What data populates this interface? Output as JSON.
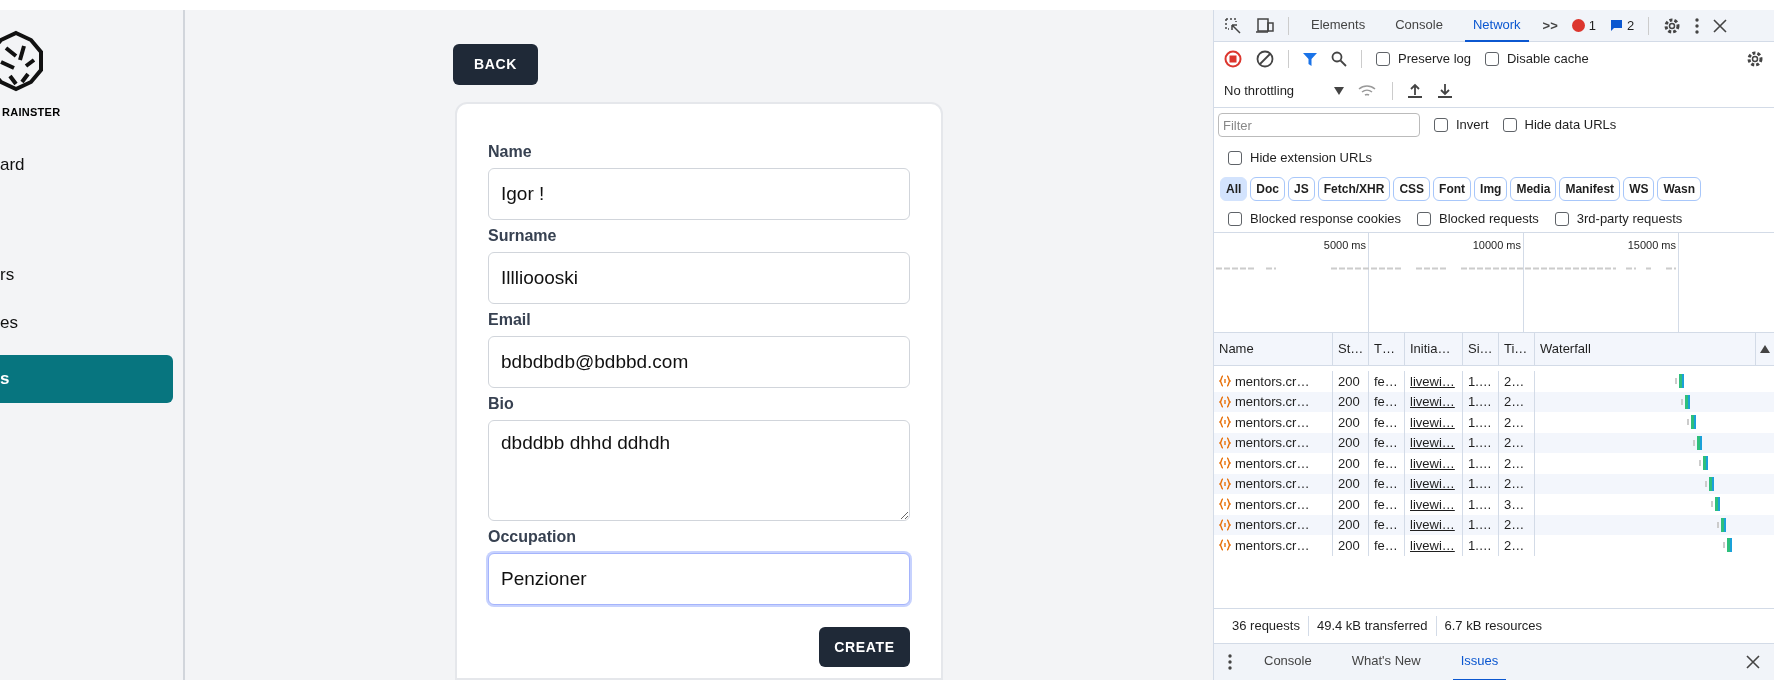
{
  "sidebar": {
    "logo_text": "RAINSTER",
    "items": [
      {
        "label": "ard",
        "selected": false
      },
      {
        "label": "rs",
        "selected": false
      },
      {
        "label": "es",
        "selected": false
      },
      {
        "label": "s",
        "selected": true
      }
    ]
  },
  "back_button": "BACK",
  "form": {
    "fields": [
      {
        "kind": "input",
        "label": "Name",
        "value": "Igor !",
        "focused": false
      },
      {
        "kind": "input",
        "label": "Surname",
        "value": "Illlioooski",
        "focused": false
      },
      {
        "kind": "input",
        "label": "Email",
        "value": "bdbdbdb@bdbbd.com",
        "focused": false
      },
      {
        "kind": "textarea",
        "label": "Bio",
        "value": "dbddbb dhhd ddhdh",
        "focused": false
      },
      {
        "kind": "input",
        "label": "Occupation",
        "value": "Penzioner",
        "focused": true
      }
    ],
    "submit": "CREATE"
  },
  "devtools": {
    "tabs": [
      {
        "label": "Elements",
        "selected": false
      },
      {
        "label": "Console",
        "selected": false
      },
      {
        "label": "Network",
        "selected": true
      }
    ],
    "more": ">>",
    "errors": "1",
    "messages": "2",
    "checkboxes_1": [
      {
        "label": "Preserve log",
        "checked": false
      },
      {
        "label": "Disable cache",
        "checked": false
      }
    ],
    "throttling": "No throttling",
    "filter_placeholder": "Filter",
    "checkboxes_2": [
      {
        "label": "Invert",
        "checked": false
      },
      {
        "label": "Hide data URLs",
        "checked": false
      },
      {
        "label": "Hide extension URLs",
        "checked": false
      }
    ],
    "type_filters": [
      {
        "label": "All",
        "selected": true
      },
      {
        "label": "Doc",
        "selected": false
      },
      {
        "label": "JS",
        "selected": false
      },
      {
        "label": "Fetch/XHR",
        "selected": false
      },
      {
        "label": "CSS",
        "selected": false
      },
      {
        "label": "Font",
        "selected": false
      },
      {
        "label": "Img",
        "selected": false
      },
      {
        "label": "Media",
        "selected": false
      },
      {
        "label": "Manifest",
        "selected": false
      },
      {
        "label": "WS",
        "selected": false
      },
      {
        "label": "Wasn",
        "selected": false
      }
    ],
    "checkboxes_3": [
      {
        "label": "Blocked response cookies",
        "checked": false
      },
      {
        "label": "Blocked requests",
        "checked": false
      },
      {
        "label": "3rd-party requests",
        "checked": false
      }
    ],
    "overview_ticks": [
      "5000 ms",
      "10000 ms",
      "15000 ms"
    ],
    "columns": [
      "Name",
      "St…",
      "T…",
      "Initia…",
      "Si…",
      "Ti…",
      "Waterfall"
    ],
    "rows": [
      [
        "mentors.cr…",
        "200",
        "fe…",
        "livewi…",
        "1.…",
        "2…"
      ],
      [
        "mentors.cr…",
        "200",
        "fe…",
        "livewi…",
        "1.…",
        "2…"
      ],
      [
        "mentors.cr…",
        "200",
        "fe…",
        "livewi…",
        "1.…",
        "2…"
      ],
      [
        "mentors.cr…",
        "200",
        "fe…",
        "livewi…",
        "1.…",
        "2…"
      ],
      [
        "mentors.cr…",
        "200",
        "fe…",
        "livewi…",
        "1.…",
        "2…"
      ],
      [
        "mentors.cr…",
        "200",
        "fe…",
        "livewi…",
        "1.…",
        "2…"
      ],
      [
        "mentors.cr…",
        "200",
        "fe…",
        "livewi…",
        "1.…",
        "3…"
      ],
      [
        "mentors.cr…",
        "200",
        "fe…",
        "livewi…",
        "1.…",
        "2…"
      ],
      [
        "mentors.cr…",
        "200",
        "fe…",
        "livewi…",
        "1.…",
        "2…"
      ]
    ],
    "status": [
      "36 requests",
      "49.4 kB transferred",
      "6.7 kB resources"
    ],
    "drawer_tabs": [
      {
        "label": "Console",
        "selected": false
      },
      {
        "label": "What's New",
        "selected": false
      },
      {
        "label": "Issues",
        "selected": true
      }
    ]
  }
}
